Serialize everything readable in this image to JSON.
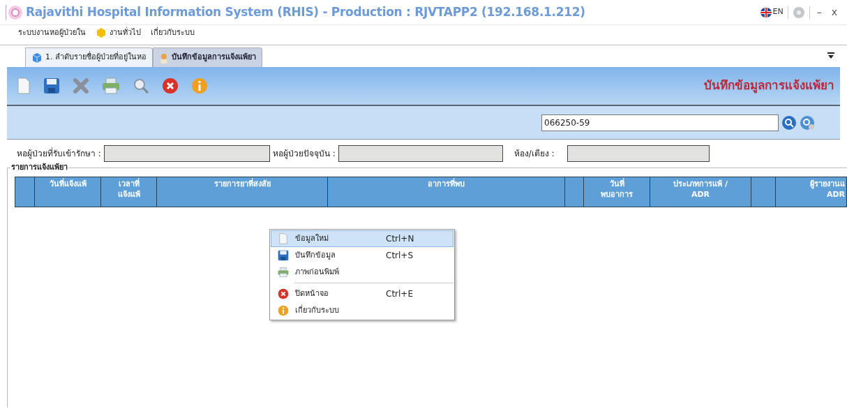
{
  "window": {
    "title": "Rajavithi Hospital Information System (RHIS) - Production : RJVTAPP2 (192.168.1.212)",
    "language": "EN",
    "controls": [
      "–",
      "x"
    ]
  },
  "menu": [
    "ระบบงานหอผู้ป่วยใน",
    "งานทั่วไป",
    "เกี่ยวกับระบบ"
  ],
  "tabs": [
    {
      "label": "1. ลำดับรายชื่อผู้ป่วยที่อยู่ในหอ",
      "selected": false
    },
    {
      "label": "บันทึกข้อมูลการแจ้งแพ้ยา",
      "selected": true
    }
  ],
  "page_title": "บันทึกข้อมูลการแจ้งแพ้ยา",
  "search": {
    "value": "066250-59"
  },
  "fields": [
    {
      "label": "หอผู้ป่วยที่รับเข้ารักษา :"
    },
    {
      "label": "หอผู้ป่วยปัจจุบัน :"
    },
    {
      "label": "ห้อง/เตียง :"
    }
  ],
  "group_title": "รายการแจ้งแพ้ยา",
  "table": {
    "columns": [
      {
        "kind": "blank"
      },
      {
        "kind": "text",
        "label": "วันที่แจ้งแพ้"
      },
      {
        "kind": "text",
        "label": "เวลาที่\nแจ้งแพ้"
      },
      {
        "kind": "text",
        "label": "รายการยาที่สงสัย"
      },
      {
        "kind": "text",
        "label": "อาการที่พบ"
      },
      {
        "kind": "blank"
      },
      {
        "kind": "text",
        "label": "วันที่\nพบอาการ"
      },
      {
        "kind": "text",
        "label": "ประเภทการแพ้ /\nADR"
      },
      {
        "kind": "blank"
      },
      {
        "kind": "text",
        "label": "ผู้รายงานแ\nADR"
      }
    ]
  },
  "context_menu": [
    {
      "kind": "item",
      "label": "ข้อมูลใหม่",
      "shortcut": "Ctrl+N",
      "selected": true
    },
    {
      "kind": "item",
      "label": "บันทึกข้อมูล",
      "shortcut": "Ctrl+S",
      "selected": false
    },
    {
      "kind": "item",
      "label": "ภาพก่อนพิมพ์",
      "selected": false
    },
    {
      "kind": "separator"
    },
    {
      "kind": "item",
      "label": "ปิดหน้าจอ",
      "shortcut": "Ctrl+E",
      "selected": false
    },
    {
      "kind": "item",
      "label": "เกี่ยวกับระบบ",
      "selected": false
    }
  ]
}
